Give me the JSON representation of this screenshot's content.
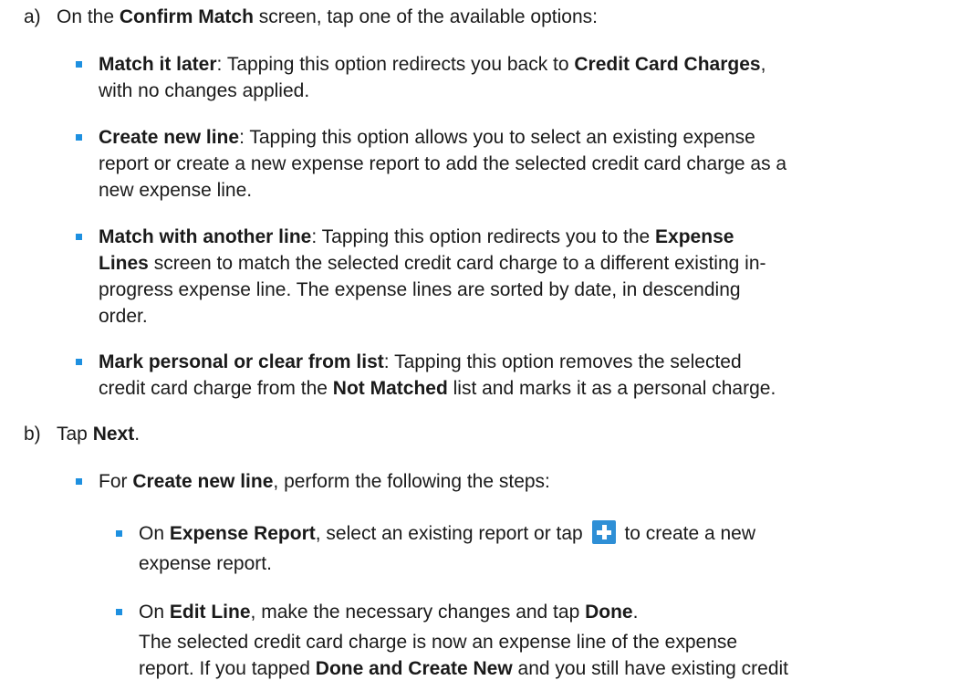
{
  "step_a": {
    "label": "a)",
    "t1": "On the ",
    "b1": "Confirm Match",
    "t2": " screen, tap one of the available options:",
    "options": {
      "match_later": {
        "b": "Match it later",
        "l1a": ": Tapping this option redirects you back to ",
        "l1b": "Credit Card Charges",
        "l1c": ",",
        "l2": "with no changes applied."
      },
      "create_new": {
        "b": "Create new line",
        "l1a": ": Tapping this option allows you to select an existing expense",
        "l2": "report or create a new expense report to add the selected credit card charge as a",
        "l3": "new expense line."
      },
      "match_another": {
        "b": "Match with another line",
        "l1a": ": Tapping this option redirects you to the ",
        "l1b": "Expense",
        "l2b": "Lines",
        "l2a": " screen to match the selected credit card charge to a different existing in-",
        "l3": "progress expense line. The expense lines are sorted by date, in descending",
        "l4": "order."
      },
      "mark_personal": {
        "b": "Mark personal or clear from list",
        "l1a": ": Tapping this option removes the selected",
        "l2a": "credit card charge from the ",
        "l2b": "Not Matched",
        "l2c": " list and marks it as a personal charge."
      }
    }
  },
  "step_b": {
    "label": "b)",
    "t1": "Tap ",
    "b1": "Next",
    "t2": ".",
    "for": {
      "t1": "For ",
      "b1": "Create new line",
      "t2": ", perform the following the steps:"
    },
    "expense_report": {
      "t1": "On ",
      "b1": "Expense Report",
      "t2": ", select an existing report or tap",
      "t3": "to create a new",
      "l2": "expense report.",
      "icon": "plus-icon"
    },
    "edit_line": {
      "t1": "On ",
      "b1": "Edit Line",
      "t2": ", make the necessary changes and tap ",
      "b2": "Done",
      "t3": ".",
      "p1": "The selected credit card charge is now an expense line of the expense",
      "p2a": "report. If you tapped ",
      "p2b": "Done and Create New",
      "p2c": " and you still have existing credit"
    }
  },
  "colors": {
    "bullet": "#1e90e0",
    "plus_button": "#2e8fd6"
  }
}
